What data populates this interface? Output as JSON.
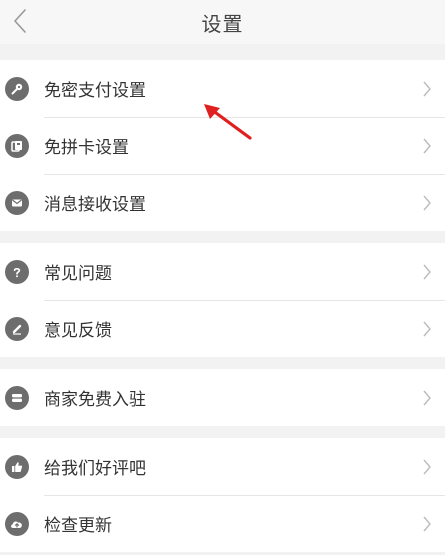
{
  "header": {
    "title": "设置"
  },
  "groups": [
    {
      "items": [
        {
          "label": "免密支付设置",
          "icon": "key-icon"
        },
        {
          "label": "免拼卡设置",
          "icon": "card-icon"
        },
        {
          "label": "消息接收设置",
          "icon": "mail-icon"
        }
      ]
    },
    {
      "items": [
        {
          "label": "常见问题",
          "icon": "question-icon"
        },
        {
          "label": "意见反馈",
          "icon": "pencil-icon"
        }
      ]
    },
    {
      "items": [
        {
          "label": "商家免费入驻",
          "icon": "store-icon"
        }
      ]
    },
    {
      "items": [
        {
          "label": "给我们好评吧",
          "icon": "thumbs-up-icon"
        },
        {
          "label": "检查更新",
          "icon": "cloud-upload-icon"
        }
      ]
    }
  ],
  "colors": {
    "icon_bg": "#6d6d6d",
    "background": "#f2f2f2",
    "annotation_arrow": "#e02020"
  }
}
